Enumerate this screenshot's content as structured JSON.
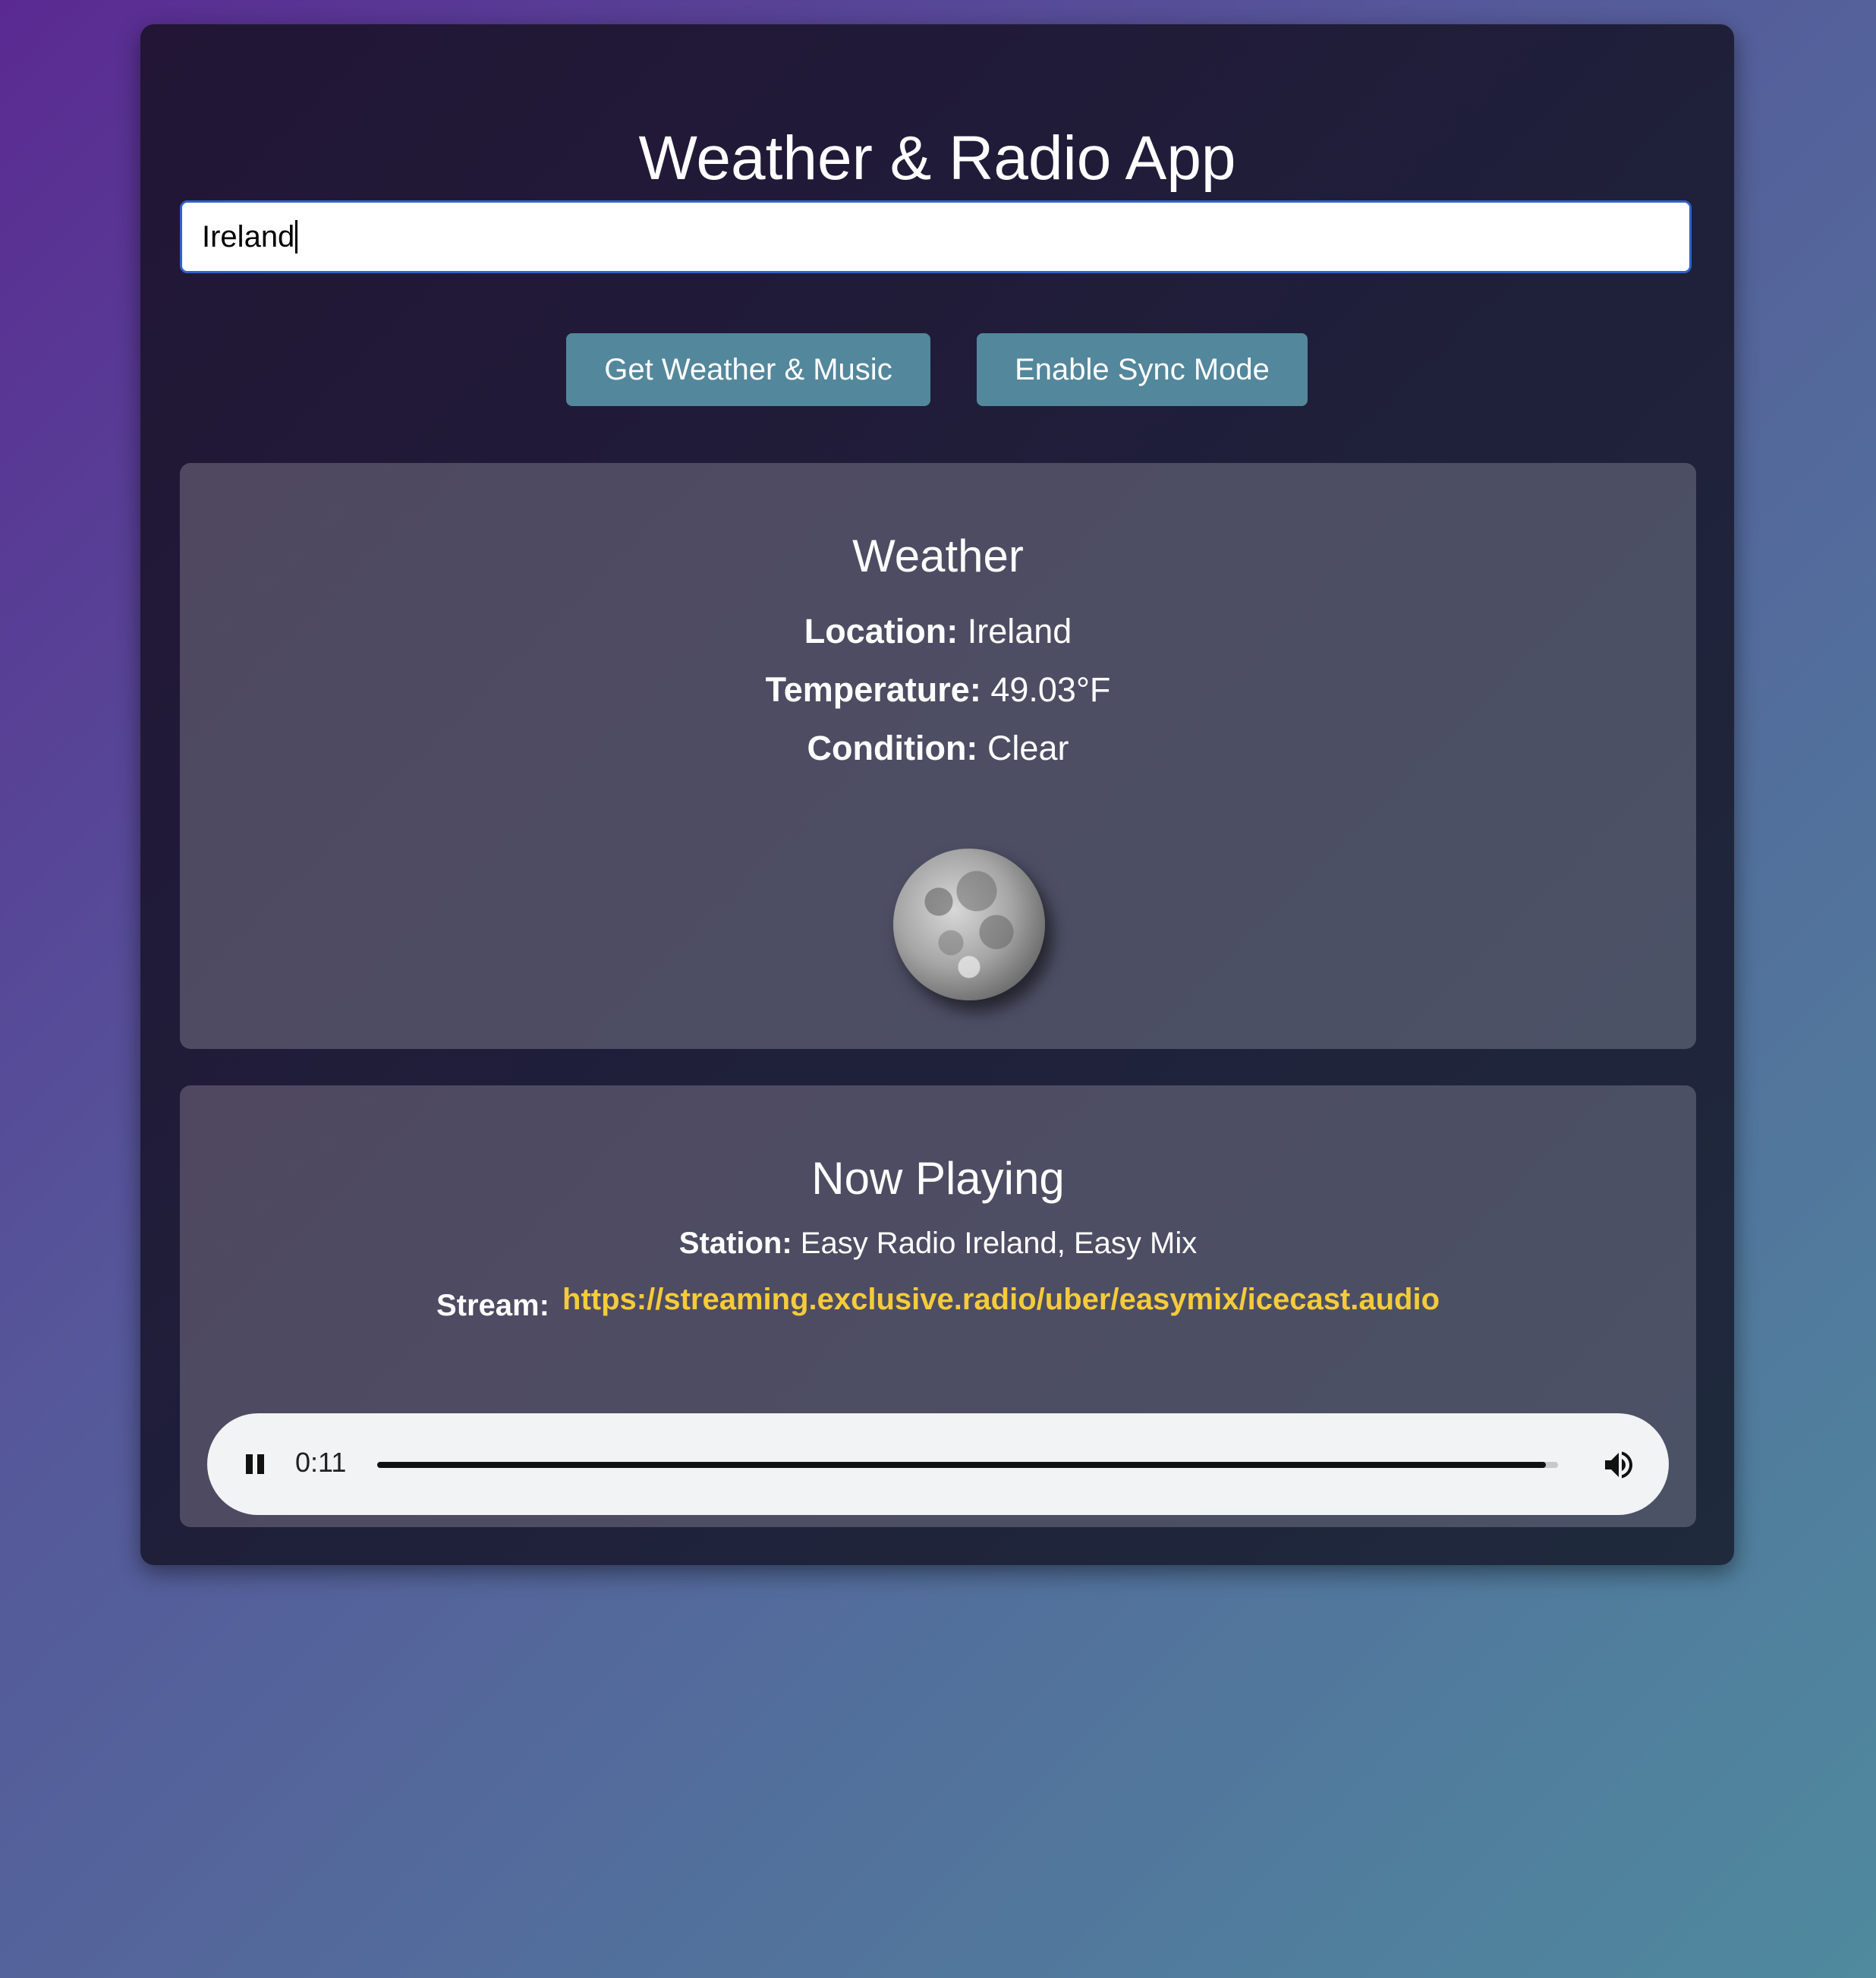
{
  "app": {
    "title": "Weather & Radio App"
  },
  "search": {
    "value": "Ireland"
  },
  "buttons": {
    "get_weather": "Get Weather & Music",
    "sync_mode": "Enable Sync Mode"
  },
  "weather": {
    "heading": "Weather",
    "location_label": "Location:",
    "location_value": "Ireland",
    "temperature_label": "Temperature:",
    "temperature_value": "49.03°F",
    "condition_label": "Condition:",
    "condition_value": "Clear",
    "icon": "moon-icon"
  },
  "radio": {
    "heading": "Now Playing",
    "station_label": "Station:",
    "station_value": "Easy Radio Ireland, Easy Mix",
    "stream_label": "Stream:",
    "stream_url": "https://streaming.exclusive.radio/uber/easymix/icecast.audio"
  },
  "player": {
    "state": "playing",
    "time": "0:11",
    "progress_fraction": 0.99
  },
  "colors": {
    "button_bg": "#53879c",
    "link": "#f5cb3a",
    "input_focus": "#2f63c8"
  }
}
